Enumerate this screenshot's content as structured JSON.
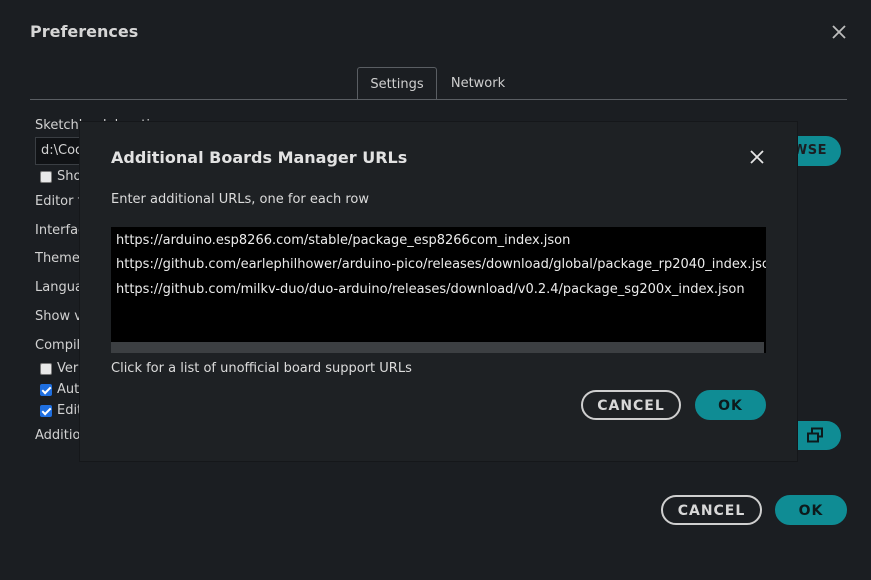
{
  "preferences": {
    "title": "Preferences",
    "tabs": [
      {
        "label": "Settings"
      },
      {
        "label": "Network"
      }
    ],
    "sketchbook": {
      "label": "Sketchbook location:",
      "value": "d:\\Coo"
    },
    "labels": {
      "show_files": "Show",
      "editor_font": "Editor f",
      "interface": "Interfac",
      "theme": "Theme:",
      "language": "Langua",
      "show_verbose": "Show v",
      "compiler": "Compil",
      "verify": "Veri",
      "auto": "Aut",
      "edit": "Edit",
      "additional": "Additio"
    },
    "browse_label": "WSE",
    "cancel_label": "CANCEL",
    "ok_label": "OK"
  },
  "dialog": {
    "title": "Additional Boards Manager URLs",
    "instructions": "Enter additional URLs, one for each row",
    "urls": [
      "https://arduino.esp8266.com/stable/package_esp8266com_index.json",
      "https://github.com/earlephilhower/arduino-pico/releases/download/global/package_rp2040_index.json",
      "https://github.com/milkv-duo/duo-arduino/releases/download/v0.2.4/package_sg200x_index.json"
    ],
    "link_text": "Click for a list of unofficial board support URLs",
    "cancel_label": "CANCEL",
    "ok_label": "OK"
  },
  "colors": {
    "accent": "#0f8c94",
    "background": "#1b1e22",
    "dialog_bg": "#1e2124"
  },
  "icons": {
    "close": "close-icon",
    "open_window": "open-window-icon"
  }
}
